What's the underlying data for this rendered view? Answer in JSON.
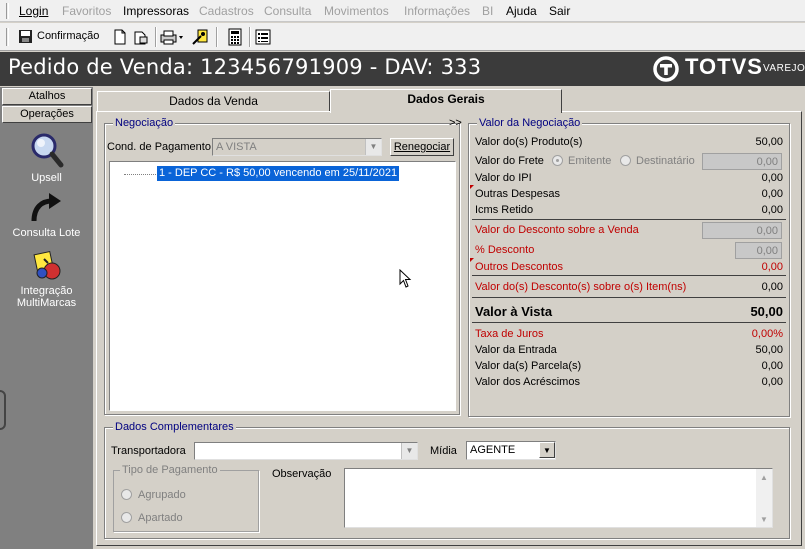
{
  "menu": {
    "items": [
      {
        "label": "Login",
        "enabled": true
      },
      {
        "label": "Favoritos",
        "enabled": false
      },
      {
        "label": "Impressoras",
        "enabled": true
      },
      {
        "label": "Cadastros",
        "enabled": false
      },
      {
        "label": "Consulta",
        "enabled": false
      },
      {
        "label": "Movimentos",
        "enabled": false
      },
      {
        "label": "Informações",
        "enabled": false
      },
      {
        "label": "BI",
        "enabled": false
      },
      {
        "label": "Ajuda",
        "enabled": true
      },
      {
        "label": "Sair",
        "enabled": true
      }
    ]
  },
  "toolbar": {
    "confirm_label": "Confirmação",
    "icons": [
      "save-icon",
      "new-document-icon",
      "export-icon",
      "print-icon",
      "wizard-icon",
      "calculator-icon",
      "list-icon"
    ]
  },
  "header": {
    "title": "Pedido de Venda: 123456791909  - DAV: 333",
    "brand": "TOTVS",
    "brand_sub": "VAREJO"
  },
  "sidebar": {
    "tabs": [
      "Atalhos",
      "Operações"
    ],
    "items": [
      {
        "label": "Upsell",
        "icon": "magnifier-icon"
      },
      {
        "label": "Consulta Lote",
        "icon": "curved-arrow-icon"
      },
      {
        "label": "Integração MultiMarcas",
        "icon": "integration-icon"
      }
    ]
  },
  "tabs": {
    "dados_venda": "Dados da Venda",
    "dados_gerais": "Dados Gerais",
    "active": "Dados Gerais"
  },
  "negociacao": {
    "legend": "Negociação",
    "expand_marker": ">>",
    "cond_label": "Cond. de Pagamento",
    "cond_value": "A VISTA",
    "renegociar_label": "Renegociar",
    "tree_item": "1 - DEP CC - R$ 50,00 vencendo em  25/11/2021"
  },
  "valor": {
    "legend": "Valor da Negociação",
    "produtos_label": "Valor do(s) Produto(s)",
    "produtos_value": "50,00",
    "frete_label": "Valor do Frete",
    "emitente_label": "Emitente",
    "destinatario_label": "Destinatário",
    "frete_value": "0,00",
    "ipi_label": "Valor do IPI",
    "ipi_value": "0,00",
    "outras_label": "Outras Despesas",
    "outras_value": "0,00",
    "icms_label": "Icms Retido",
    "icms_value": "0,00",
    "desconto_venda_label": "Valor do Desconto sobre a Venda",
    "desconto_venda_value": "0,00",
    "pct_desconto_label": "% Desconto",
    "pct_desconto_value": "0,00",
    "outros_desc_label": "Outros Descontos",
    "outros_desc_value": "0,00",
    "desc_itens_label": "Valor do(s) Desconto(s) sobre o(s) Item(ns)",
    "desc_itens_value": "0,00",
    "avista_label": "Valor à Vista",
    "avista_value": "50,00",
    "juros_label": "Taxa de Juros",
    "juros_value": "0,00%",
    "entrada_label": "Valor da Entrada",
    "entrada_value": "50,00",
    "parcelas_label": "Valor da(s) Parcela(s)",
    "parcelas_value": "0,00",
    "acrescimos_label": "Valor dos Acréscimos",
    "acrescimos_value": "0,00"
  },
  "complementares": {
    "legend": "Dados Complementares",
    "transportadora_label": "Transportadora",
    "transportadora_value": "",
    "midia_label": "Mídia",
    "midia_value": "AGENTE",
    "tipo_pagamento_legend": "Tipo de Pagamento",
    "agrupado_label": "Agrupado",
    "apartado_label": "Apartado",
    "observacao_label": "Observação",
    "observacao_value": ""
  },
  "colors": {
    "header_bg": "#3b3b3b",
    "sidebar_bg": "#808080",
    "legend_blue": "#000080",
    "emphasis_red": "#c00000",
    "selection_blue": "#0a64d8"
  }
}
